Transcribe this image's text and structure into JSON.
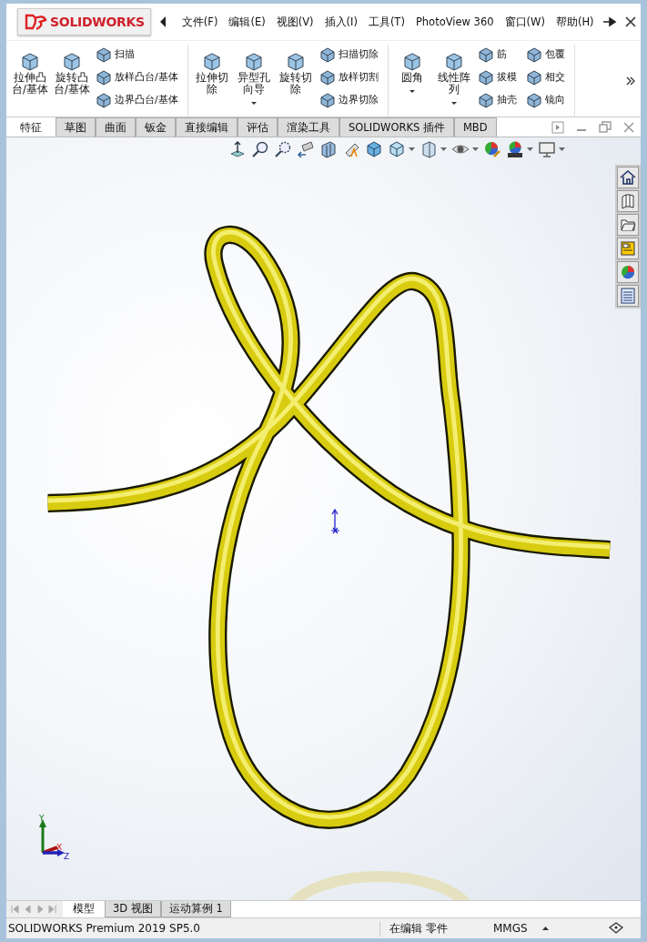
{
  "logo": {
    "text": "**SOLID**WORKS"
  },
  "menu": [
    "文件(F)",
    "编辑(E)",
    "视图(V)",
    "插入(I)",
    "工具(T)",
    "PhotoView 360",
    "窗口(W)",
    "帮助(H)"
  ],
  "ribbon": [
    {
      "items": [
        {
          "kind": "large",
          "label": "拉伸凸台/基体",
          "dropdown": false
        },
        {
          "kind": "large",
          "label": "旋转凸台/基体",
          "dropdown": false
        },
        {
          "kind": "stack",
          "labels": [
            "扫描",
            "放样凸台/基体",
            "边界凸台/基体"
          ]
        }
      ]
    },
    {
      "items": [
        {
          "kind": "large",
          "label": "拉伸切除",
          "dropdown": false
        },
        {
          "kind": "large",
          "label": "异型孔向导",
          "dropdown": true
        },
        {
          "kind": "large",
          "label": "旋转切除",
          "dropdown": false
        },
        {
          "kind": "stack",
          "labels": [
            "扫描切除",
            "放样切割",
            "边界切除"
          ]
        }
      ]
    },
    {
      "items": [
        {
          "kind": "large",
          "label": "圆角",
          "dropdown": true
        },
        {
          "kind": "large",
          "label": "线性阵列",
          "dropdown": true
        },
        {
          "kind": "stack",
          "labels": [
            "筋",
            "拔模",
            "抽壳"
          ]
        },
        {
          "kind": "stack",
          "labels": [
            "包覆",
            "相交",
            "镜向"
          ]
        }
      ]
    }
  ],
  "tabs": [
    {
      "label": "特征",
      "selected": true
    },
    {
      "label": "草图",
      "selected": false
    },
    {
      "label": "曲面",
      "selected": false
    },
    {
      "label": "钣金",
      "selected": false
    },
    {
      "label": "直接编辑",
      "selected": false
    },
    {
      "label": "评估",
      "selected": false
    },
    {
      "label": "渲染工具",
      "selected": false
    },
    {
      "label": "SOLIDWORKS 插件",
      "selected": false
    },
    {
      "label": "MBD",
      "selected": false
    }
  ],
  "triad": {
    "x": "X",
    "y": "Y",
    "z": "Z"
  },
  "bottom_tabs": [
    {
      "label": "模型",
      "selected": true
    },
    {
      "label": "3D 视图",
      "selected": false
    },
    {
      "label": "运动算例 1",
      "selected": false
    }
  ],
  "status_bar": {
    "product": "SOLIDWORKS Premium 2019 SP5.0",
    "mode": "在编辑 零件",
    "units": "MMGS"
  }
}
